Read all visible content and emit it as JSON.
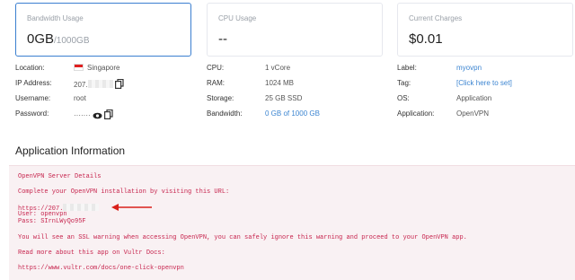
{
  "cards": [
    {
      "title": "Bandwidth Usage",
      "value": "0GB",
      "unit": "/1000GB"
    },
    {
      "title": "CPU Usage",
      "value": "--",
      "unit": ""
    },
    {
      "title": "Current Charges",
      "value": "$0.01",
      "unit": ""
    }
  ],
  "details": {
    "col1": [
      {
        "label": "Location:",
        "value": "Singapore"
      },
      {
        "label": "IP Address:",
        "value": "207."
      },
      {
        "label": "Username:",
        "value": "root"
      },
      {
        "label": "Password:",
        "value": "·······"
      }
    ],
    "col2": [
      {
        "label": "CPU:",
        "value": "1 vCore"
      },
      {
        "label": "RAM:",
        "value": "1024 MB"
      },
      {
        "label": "Storage:",
        "value": "25 GB SSD"
      },
      {
        "label": "Bandwidth:",
        "value": "0 GB of 1000 GB"
      }
    ],
    "col3": [
      {
        "label": "Label:",
        "value": "myovpn"
      },
      {
        "label": "Tag:",
        "value": "[Click here to set]"
      },
      {
        "label": "OS:",
        "value": "Application"
      },
      {
        "label": "Application:",
        "value": "OpenVPN"
      }
    ]
  },
  "app_info": {
    "heading": "Application Information",
    "lines": [
      "OpenVPN Server Details",
      "Complete your OpenVPN installation by visiting this URL:",
      "https://207.",
      "User: openvpn",
      "Pass: SIrnLWyQo95F",
      "You will see an SSL warning when accessing OpenVPN, you can safely ignore this warning and proceed to your OpenVPN app.",
      "Read more about this app on Vultr Docs:",
      "https://www.vultr.com/docs/one-click-openvpn"
    ]
  },
  "colors": {
    "accent": "#3c85d1",
    "code": "#c7254e",
    "code_bg": "#f9f1f3",
    "arrow": "#d9201a"
  }
}
